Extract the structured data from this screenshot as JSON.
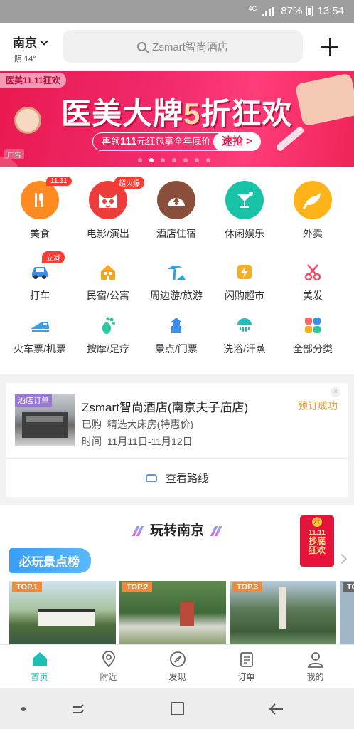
{
  "status_bar": {
    "network": "4G",
    "battery": "87%",
    "time": "13:54"
  },
  "header": {
    "city": "南京",
    "weather": "阴 14°",
    "search_placeholder": "Zsmart智尚酒店",
    "add_icon": "plus-icon"
  },
  "banner": {
    "tag": "医美11.11狂欢",
    "title_prefix": "医美大牌",
    "title_number": "5",
    "title_suffix": "折狂欢",
    "sub_prefix": "再领",
    "sub_amount": "111",
    "sub_suffix": "元红包享全年底价",
    "cta": "速抢 >",
    "ad_label": "广告",
    "page_count": 7,
    "active_page": 1
  },
  "categories": [
    {
      "label": "美食",
      "icon": "fork-knife-icon",
      "color": "#ff8a1f",
      "badge": "11.11"
    },
    {
      "label": "电影/演出",
      "icon": "cat-icon",
      "color": "#f03b3b",
      "badge": "超火爆"
    },
    {
      "label": "酒店住宿",
      "icon": "hotel-icon",
      "color": "#8a4f3a",
      "badge": ""
    },
    {
      "label": "休闲娱乐",
      "icon": "cocktail-icon",
      "color": "#18c2a7",
      "badge": ""
    },
    {
      "label": "外卖",
      "icon": "kangaroo-icon",
      "color": "#ffb31a",
      "badge": ""
    },
    {
      "label": "打车",
      "icon": "car-icon",
      "color": "#3b8ef0",
      "badge": "立减"
    },
    {
      "label": "民宿/公寓",
      "icon": "house-icon",
      "color": "#f5a623",
      "badge": ""
    },
    {
      "label": "周边游/旅游",
      "icon": "palm-tree-icon",
      "color": "#23a6e8",
      "badge": ""
    },
    {
      "label": "闪购超市",
      "icon": "lightning-icon",
      "color": "#f5b01a",
      "badge": ""
    },
    {
      "label": "美发",
      "icon": "scissors-icon",
      "color": "#f24b6a",
      "badge": ""
    },
    {
      "label": "火车票/机票",
      "icon": "train-icon",
      "color": "#3aa0f0",
      "badge": ""
    },
    {
      "label": "按摩/足疗",
      "icon": "foot-icon",
      "color": "#2ac7a0",
      "badge": ""
    },
    {
      "label": "景点/门票",
      "icon": "pagoda-icon",
      "color": "#3a8ef0",
      "badge": ""
    },
    {
      "label": "洗浴/汗蒸",
      "icon": "shower-icon",
      "color": "#21c0c0",
      "badge": ""
    },
    {
      "label": "全部分类",
      "icon": "grid-icon",
      "color": "#f56b6b",
      "badge": ""
    }
  ],
  "order": {
    "photo_tag": "酒店订单",
    "hotel": "Zsmart智尚酒店(南京夫子庙店)",
    "status": "预订成功",
    "purchased_label": "已购",
    "purchased_value": "精选大床房(特惠价)",
    "time_label": "时间",
    "time_value": "11月11日-11月12日",
    "route_label": "查看路线"
  },
  "play": {
    "title": "玩转南京",
    "rank_label": "必玩景点榜",
    "red_envelope": {
      "top": "开",
      "line1": "11.11",
      "line2": "抄底",
      "line3": "狂欢"
    },
    "spots": [
      {
        "tag": "TOP.1"
      },
      {
        "tag": "TOP.2"
      },
      {
        "tag": "TOP.3"
      },
      {
        "tag": "TO"
      }
    ]
  },
  "tabs": [
    {
      "label": "首页",
      "icon": "home-icon",
      "active": true
    },
    {
      "label": "附近",
      "icon": "location-pin-icon",
      "active": false
    },
    {
      "label": "发现",
      "icon": "compass-icon",
      "active": false
    },
    {
      "label": "订单",
      "icon": "clipboard-icon",
      "active": false
    },
    {
      "label": "我的",
      "icon": "user-icon",
      "active": false
    }
  ],
  "colors": {
    "accent": "#1dbfb2",
    "banner": "#ef2457",
    "order_status": "#f1a33c"
  }
}
